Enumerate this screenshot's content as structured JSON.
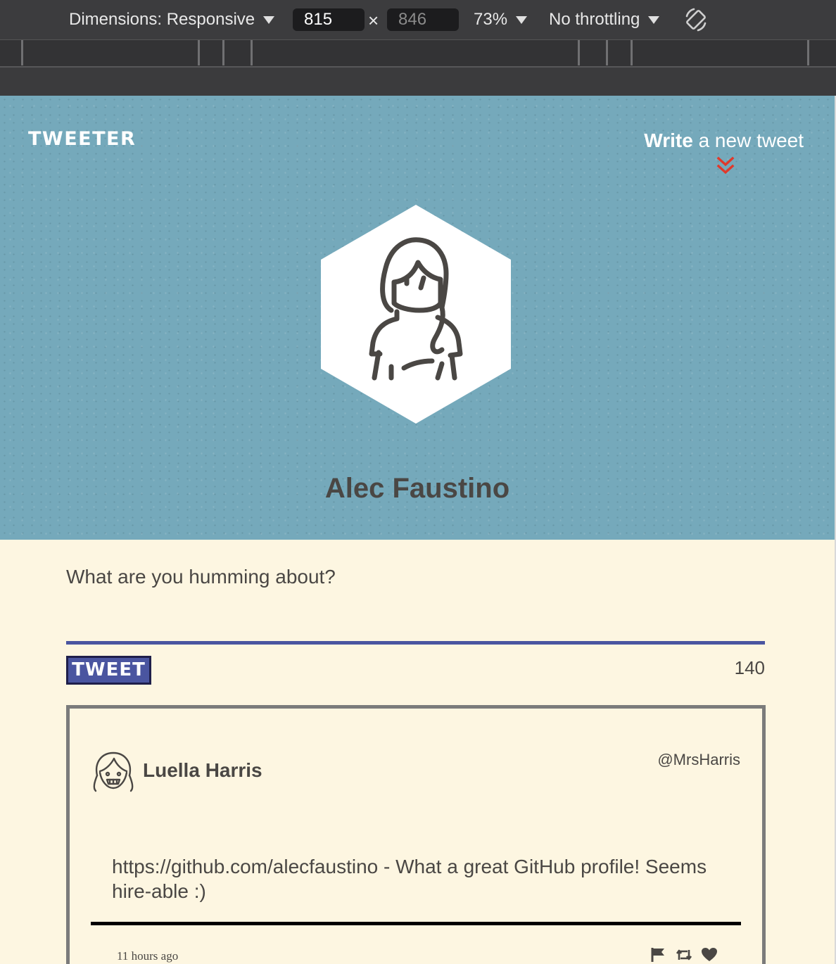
{
  "devtools": {
    "dimensions_label": "Dimensions: Responsive",
    "width": "815",
    "height": "846",
    "times": "×",
    "zoom": "73%",
    "throttling": "No throttling",
    "rotate_icon": "rotate-device-icon"
  },
  "header": {
    "logo": "TWEETER",
    "write_bold": "Write",
    "write_rest": " a new tweet",
    "write_icon": "double-chevron-down-icon",
    "accent_color": "#e0392b"
  },
  "profile": {
    "name": "Alec Faustino",
    "avatar_icon": "woman-avatar-icon"
  },
  "compose": {
    "placeholder": "What are you humming about?",
    "button_label": "TWEET",
    "counter": "140",
    "bar_color": "#4a55a0"
  },
  "tweets": [
    {
      "name": "Luella Harris",
      "handle": "@MrsHarris",
      "avatar_icon": "girl-avatar-icon",
      "text": "https://github.com/alecfaustino - What a great GitHub profile! Seems hire-able :)",
      "time": "11 hours ago",
      "actions": [
        "flag-icon",
        "retweet-icon",
        "heart-icon"
      ]
    }
  ]
}
